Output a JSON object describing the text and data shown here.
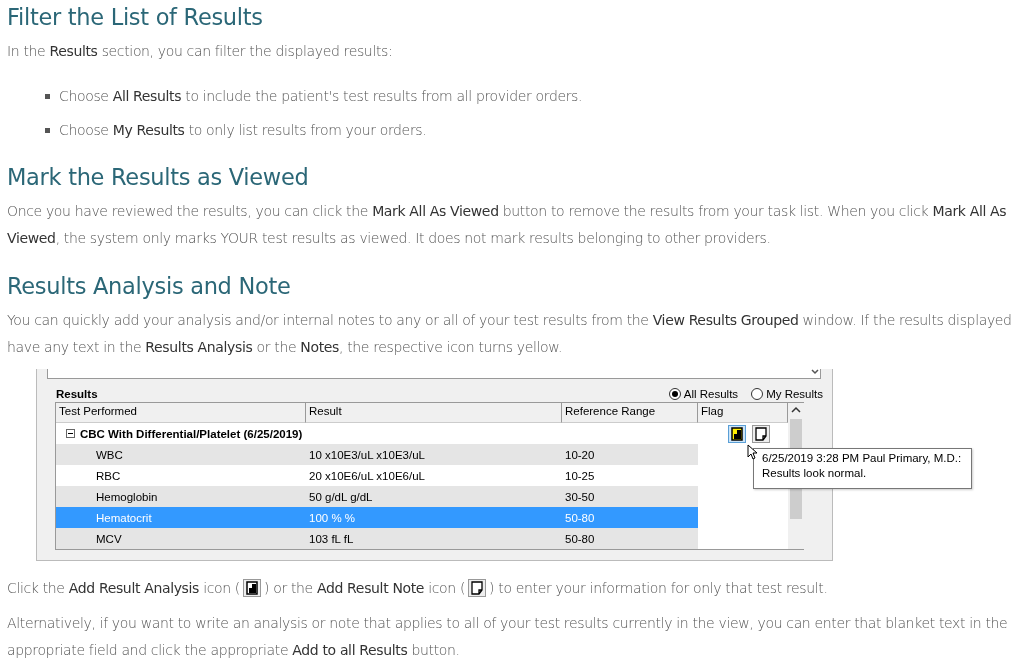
{
  "blocks": [
    {
      "kind": "heading",
      "text": "Filter the List of Results"
    },
    {
      "kind": "paragraph",
      "text": "In the **Results** section, you can filter the displayed results:"
    },
    {
      "kind": "bullets",
      "items": [
        "Choose **All Results** to include the patient's test results from all provider orders.",
        "Choose **My Results** to only list results from your orders."
      ]
    },
    {
      "kind": "heading",
      "text": "Mark the Results as Viewed"
    },
    {
      "kind": "paragraph",
      "text": "Once you have reviewed the results, you can click the **Mark All As Viewed** button to remove the results from your task list. When you click **Mark All As Viewed**, the system only marks YOUR test results as viewed. It does not mark results belonging to other providers."
    },
    {
      "kind": "heading",
      "text": "Results Analysis and Note"
    },
    {
      "kind": "paragraph",
      "text": "You can quickly add your analysis and/or internal notes to any or all of your test results from the **View Results Grouped** window. If the results displayed have any text in the **Results Analysis** or the **Notes**, the respective icon turns yellow."
    },
    {
      "kind": "screenshot"
    },
    {
      "kind": "icon_paragraph",
      "parts": [
        "Click the **Add Result Analysis** icon (",
        ") or the **Add Result Note** icon (",
        ") to enter your information for only that test result."
      ]
    },
    {
      "kind": "paragraph",
      "text": "Alternatively, if you want to write an analysis or note that applies to all of your test results currently in the view, you can enter that blanket text in the appropriate field and click the appropriate **Add to all Results** button."
    }
  ],
  "results_window": {
    "section_label": "Results",
    "radios": [
      {
        "label": "All Results",
        "selected": true
      },
      {
        "label": "My Results",
        "selected": false
      }
    ],
    "columns": [
      "Test Performed",
      "Result",
      "Reference Range",
      "Flag"
    ],
    "group": {
      "title": "CBC With Differential/Platelet  (6/25/2019)",
      "expanded": true,
      "analysis_filled": true,
      "note_filled": false
    },
    "rows": [
      {
        "test": "WBC",
        "result": "10 x10E3/uL x10E3/uL",
        "range": "10-20",
        "selected": false
      },
      {
        "test": "RBC",
        "result": "20 x10E6/uL x10E6/uL",
        "range": "10-25",
        "selected": false
      },
      {
        "test": "Hemoglobin",
        "result": "50 g/dL g/dL",
        "range": "30-50",
        "selected": false
      },
      {
        "test": "Hematocrit",
        "result": "100 % %",
        "range": "50-80",
        "selected": true
      },
      {
        "test": "MCV",
        "result": "103 fL fL",
        "range": "50-80",
        "selected": false
      }
    ],
    "tooltip": [
      "6/25/2019 3:28  PM Paul Primary, M.D.:",
      "Results look normal."
    ]
  }
}
